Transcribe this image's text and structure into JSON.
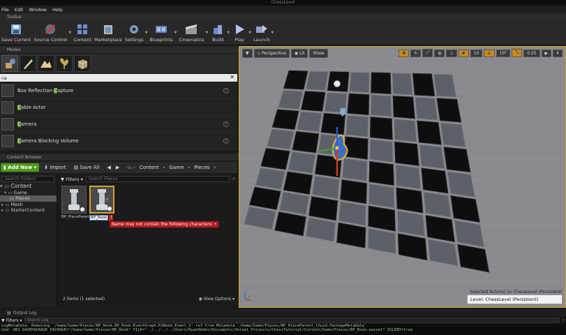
{
  "window": {
    "title": "ChessLevel"
  },
  "menu": [
    "File",
    "Edit",
    "Window",
    "Help"
  ],
  "toolbar_tab": "Toolbar",
  "toolbar": [
    {
      "label": "Save Current",
      "icon": "save-icon",
      "color": "#6f8fc0"
    },
    {
      "label": "Source Control",
      "icon": "source-control-icon",
      "color": "#c04040"
    },
    {
      "label": "Content",
      "icon": "content-icon",
      "color": "#5a7fb8"
    },
    {
      "label": "Marketplace",
      "icon": "marketplace-icon",
      "color": "#8a8a8a"
    },
    {
      "label": "Settings",
      "icon": "settings-icon",
      "color": "#6a84a6"
    },
    {
      "label": "Blueprints",
      "icon": "blueprints-icon",
      "color": "#5e7ab0"
    },
    {
      "label": "Cinematics",
      "icon": "cinematics-icon",
      "color": "#8a8a8a"
    },
    {
      "label": "Build",
      "icon": "build-icon",
      "color": "#6d86c6"
    },
    {
      "label": "Play",
      "icon": "play-icon",
      "color": "#a9b8e0"
    },
    {
      "label": "Launch",
      "icon": "launch-icon",
      "color": "#8fa0c4"
    }
  ],
  "modes": {
    "tab": "Modes",
    "search_value": "ca",
    "items": [
      {
        "pre": "Box Reflection ",
        "hl": "C",
        "post": "apture",
        "help": true
      },
      {
        "pre": "",
        "hl": "C",
        "post": "able Actor",
        "help": false
      },
      {
        "pre": "",
        "hl": "C",
        "post": "amera",
        "help": true
      },
      {
        "pre": "",
        "hl": "C",
        "post": "amera Blocking Volume",
        "help": true
      }
    ]
  },
  "content_browser": {
    "tab": "Content Browser",
    "add_new": "Add New",
    "import": "Import",
    "save_all": "Save All",
    "breadcrumb": [
      "Content",
      "Game",
      "Pieces"
    ],
    "folder_search_placeholder": "Search Folders",
    "tree": [
      {
        "label": "Content",
        "indent": 0,
        "big": true
      },
      {
        "label": "Game",
        "indent": 1
      },
      {
        "label": "Pieces",
        "indent": 2,
        "selected": true
      },
      {
        "label": "Mesh",
        "indent": 1
      },
      {
        "label": "StarterContent",
        "indent": 1
      }
    ],
    "filters": "Filters",
    "asset_search_placeholder": "Search Pieces",
    "assets": [
      {
        "label": "BP_PieceParent",
        "selected": false
      },
      {
        "label": "BP_Rook",
        "selected": true
      }
    ],
    "rename_value": "BP_Rook",
    "error_badge": "!",
    "error_message": "Name may not contain the following characters: •",
    "status": "2 items (1 selected)",
    "view_options": "View Options"
  },
  "viewport": {
    "perspective": "Perspective",
    "lit": "Lit",
    "show": "Show",
    "grid_value": "10",
    "angle_value": "10°",
    "scale_value": "0.25",
    "speed_value": "4",
    "selected_actor": "Selected Actor(s) in:  ChessLevel (Persistent)",
    "level": "Level:  ChessLevel (Persistent)"
  },
  "output_log": {
    "tab": "Output Log",
    "filters": "Filters",
    "search_placeholder": "Search Log",
    "lines": [
      "LogMetaData: Removing `/Game/Game/Pieces/BP_Rook.BP_Rook:EventGraph.K2Node_Event_2' ref from Metadata `/Game/Game/Pieces/BP_PieceParent_lhuid.PackageMetaData`",
      "Cmd: OBJ SAVEPACKAGE PACKAGE=\"/Game/Game/Pieces/BP_Rook\" FILE=\"../../../../Users/RyanHobbs/Documents/Unreal Projects/ChessTutorial/Content/Game/Pieces/BP_Rook.uasset\" SILENT=true"
    ]
  }
}
